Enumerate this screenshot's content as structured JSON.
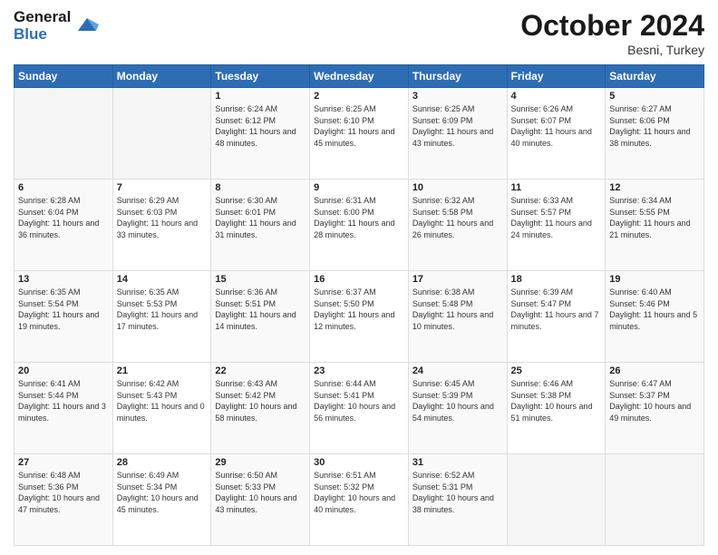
{
  "header": {
    "logo_line1": "General",
    "logo_line2": "Blue",
    "month_title": "October 2024",
    "location": "Besni, Turkey"
  },
  "weekdays": [
    "Sunday",
    "Monday",
    "Tuesday",
    "Wednesday",
    "Thursday",
    "Friday",
    "Saturday"
  ],
  "weeks": [
    [
      {
        "day": "",
        "info": ""
      },
      {
        "day": "",
        "info": ""
      },
      {
        "day": "1",
        "info": "Sunrise: 6:24 AM\nSunset: 6:12 PM\nDaylight: 11 hours and 48 minutes."
      },
      {
        "day": "2",
        "info": "Sunrise: 6:25 AM\nSunset: 6:10 PM\nDaylight: 11 hours and 45 minutes."
      },
      {
        "day": "3",
        "info": "Sunrise: 6:25 AM\nSunset: 6:09 PM\nDaylight: 11 hours and 43 minutes."
      },
      {
        "day": "4",
        "info": "Sunrise: 6:26 AM\nSunset: 6:07 PM\nDaylight: 11 hours and 40 minutes."
      },
      {
        "day": "5",
        "info": "Sunrise: 6:27 AM\nSunset: 6:06 PM\nDaylight: 11 hours and 38 minutes."
      }
    ],
    [
      {
        "day": "6",
        "info": "Sunrise: 6:28 AM\nSunset: 6:04 PM\nDaylight: 11 hours and 36 minutes."
      },
      {
        "day": "7",
        "info": "Sunrise: 6:29 AM\nSunset: 6:03 PM\nDaylight: 11 hours and 33 minutes."
      },
      {
        "day": "8",
        "info": "Sunrise: 6:30 AM\nSunset: 6:01 PM\nDaylight: 11 hours and 31 minutes."
      },
      {
        "day": "9",
        "info": "Sunrise: 6:31 AM\nSunset: 6:00 PM\nDaylight: 11 hours and 28 minutes."
      },
      {
        "day": "10",
        "info": "Sunrise: 6:32 AM\nSunset: 5:58 PM\nDaylight: 11 hours and 26 minutes."
      },
      {
        "day": "11",
        "info": "Sunrise: 6:33 AM\nSunset: 5:57 PM\nDaylight: 11 hours and 24 minutes."
      },
      {
        "day": "12",
        "info": "Sunrise: 6:34 AM\nSunset: 5:55 PM\nDaylight: 11 hours and 21 minutes."
      }
    ],
    [
      {
        "day": "13",
        "info": "Sunrise: 6:35 AM\nSunset: 5:54 PM\nDaylight: 11 hours and 19 minutes."
      },
      {
        "day": "14",
        "info": "Sunrise: 6:35 AM\nSunset: 5:53 PM\nDaylight: 11 hours and 17 minutes."
      },
      {
        "day": "15",
        "info": "Sunrise: 6:36 AM\nSunset: 5:51 PM\nDaylight: 11 hours and 14 minutes."
      },
      {
        "day": "16",
        "info": "Sunrise: 6:37 AM\nSunset: 5:50 PM\nDaylight: 11 hours and 12 minutes."
      },
      {
        "day": "17",
        "info": "Sunrise: 6:38 AM\nSunset: 5:48 PM\nDaylight: 11 hours and 10 minutes."
      },
      {
        "day": "18",
        "info": "Sunrise: 6:39 AM\nSunset: 5:47 PM\nDaylight: 11 hours and 7 minutes."
      },
      {
        "day": "19",
        "info": "Sunrise: 6:40 AM\nSunset: 5:46 PM\nDaylight: 11 hours and 5 minutes."
      }
    ],
    [
      {
        "day": "20",
        "info": "Sunrise: 6:41 AM\nSunset: 5:44 PM\nDaylight: 11 hours and 3 minutes."
      },
      {
        "day": "21",
        "info": "Sunrise: 6:42 AM\nSunset: 5:43 PM\nDaylight: 11 hours and 0 minutes."
      },
      {
        "day": "22",
        "info": "Sunrise: 6:43 AM\nSunset: 5:42 PM\nDaylight: 10 hours and 58 minutes."
      },
      {
        "day": "23",
        "info": "Sunrise: 6:44 AM\nSunset: 5:41 PM\nDaylight: 10 hours and 56 minutes."
      },
      {
        "day": "24",
        "info": "Sunrise: 6:45 AM\nSunset: 5:39 PM\nDaylight: 10 hours and 54 minutes."
      },
      {
        "day": "25",
        "info": "Sunrise: 6:46 AM\nSunset: 5:38 PM\nDaylight: 10 hours and 51 minutes."
      },
      {
        "day": "26",
        "info": "Sunrise: 6:47 AM\nSunset: 5:37 PM\nDaylight: 10 hours and 49 minutes."
      }
    ],
    [
      {
        "day": "27",
        "info": "Sunrise: 6:48 AM\nSunset: 5:36 PM\nDaylight: 10 hours and 47 minutes."
      },
      {
        "day": "28",
        "info": "Sunrise: 6:49 AM\nSunset: 5:34 PM\nDaylight: 10 hours and 45 minutes."
      },
      {
        "day": "29",
        "info": "Sunrise: 6:50 AM\nSunset: 5:33 PM\nDaylight: 10 hours and 43 minutes."
      },
      {
        "day": "30",
        "info": "Sunrise: 6:51 AM\nSunset: 5:32 PM\nDaylight: 10 hours and 40 minutes."
      },
      {
        "day": "31",
        "info": "Sunrise: 6:52 AM\nSunset: 5:31 PM\nDaylight: 10 hours and 38 minutes."
      },
      {
        "day": "",
        "info": ""
      },
      {
        "day": "",
        "info": ""
      }
    ]
  ]
}
